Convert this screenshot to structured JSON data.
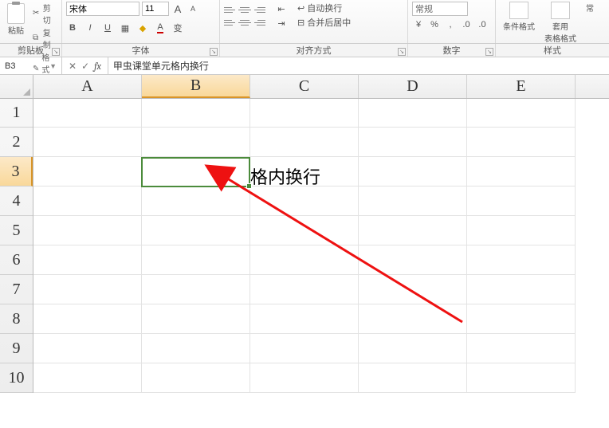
{
  "ribbon": {
    "clipboard": {
      "paste": "粘贴",
      "cut": "剪切",
      "copy": "复制",
      "format_painter": "格式刷",
      "group": "剪贴板"
    },
    "font": {
      "name": "宋体",
      "size": "11",
      "increase": "A",
      "decrease": "A",
      "bold": "B",
      "italic": "I",
      "underline": "U",
      "group": "字体"
    },
    "alignment": {
      "wrap": "自动换行",
      "merge": "合并后居中",
      "group": "对齐方式"
    },
    "number": {
      "format": "常规",
      "group": "数字"
    },
    "styles": {
      "cond": "条件格式",
      "table": "套用\n表格格式",
      "cell_style": "常",
      "group": "样式"
    }
  },
  "namebox": "B3",
  "formula": "甲虫课堂单元格内换行",
  "columns": [
    "A",
    "B",
    "C",
    "D",
    "E"
  ],
  "rows": [
    "1",
    "2",
    "3",
    "4",
    "5",
    "6",
    "7",
    "8",
    "9",
    "10"
  ],
  "cell_text": "甲虫课堂单元格内换行",
  "active": {
    "col": 1,
    "row": 2
  }
}
